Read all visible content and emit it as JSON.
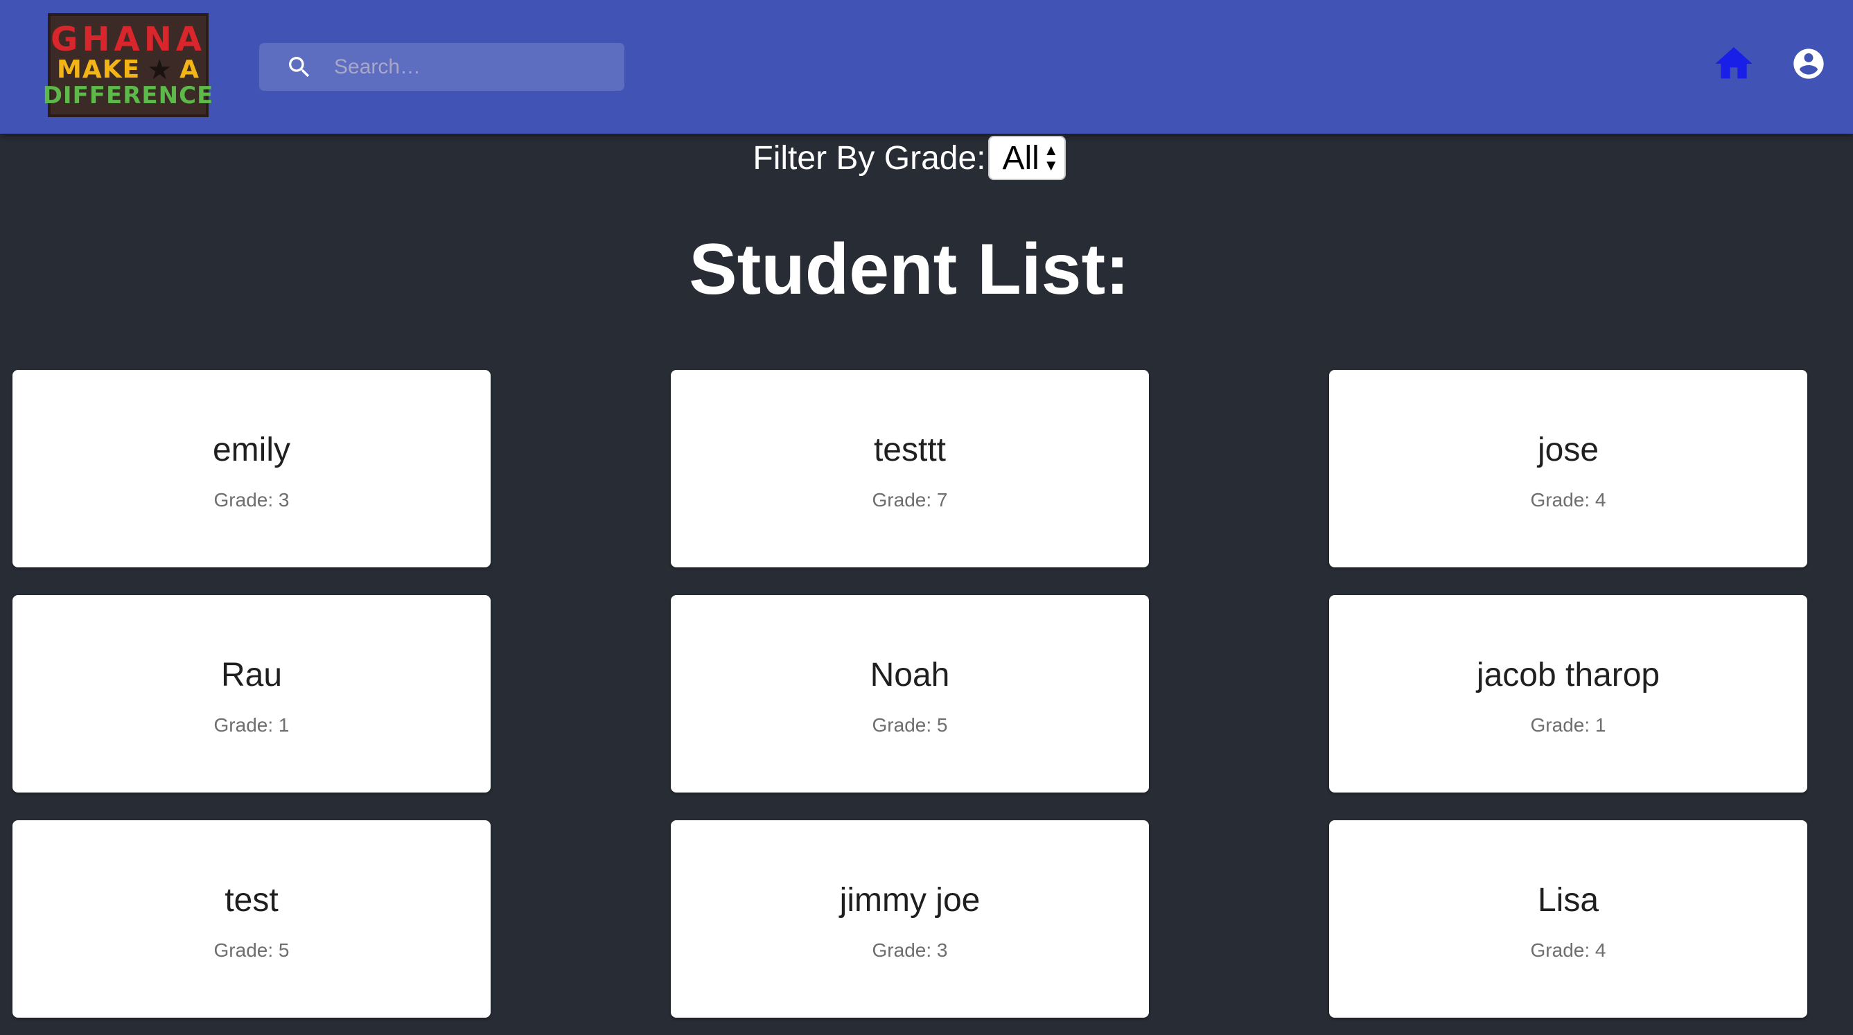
{
  "header": {
    "logo": {
      "line1": "GHANA",
      "line2_left": "MAKE",
      "line2_star": "★",
      "line2_right": "A",
      "line3": "DIFFERENCE"
    },
    "search": {
      "placeholder": "Search…",
      "value": ""
    },
    "icons": {
      "search": "search-icon",
      "home": "home-icon",
      "account": "account-circle-icon"
    },
    "colors": {
      "appbar": "#4154b5",
      "home_icon": "#1a1fe8",
      "account_icon": "#ffffff"
    }
  },
  "filter": {
    "label": "Filter By Grade:",
    "selected": "All"
  },
  "main": {
    "title": "Student List:"
  },
  "students": [
    {
      "name": "emily",
      "grade_label": "Grade: 3"
    },
    {
      "name": "testtt",
      "grade_label": "Grade: 7"
    },
    {
      "name": "jose",
      "grade_label": "Grade: 4"
    },
    {
      "name": "Rau",
      "grade_label": "Grade: 1"
    },
    {
      "name": "Noah",
      "grade_label": "Grade: 5"
    },
    {
      "name": "jacob tharop",
      "grade_label": "Grade: 1"
    },
    {
      "name": "test",
      "grade_label": "Grade: 5"
    },
    {
      "name": "jimmy joe",
      "grade_label": "Grade: 3"
    },
    {
      "name": "Lisa",
      "grade_label": "Grade: 4"
    }
  ]
}
